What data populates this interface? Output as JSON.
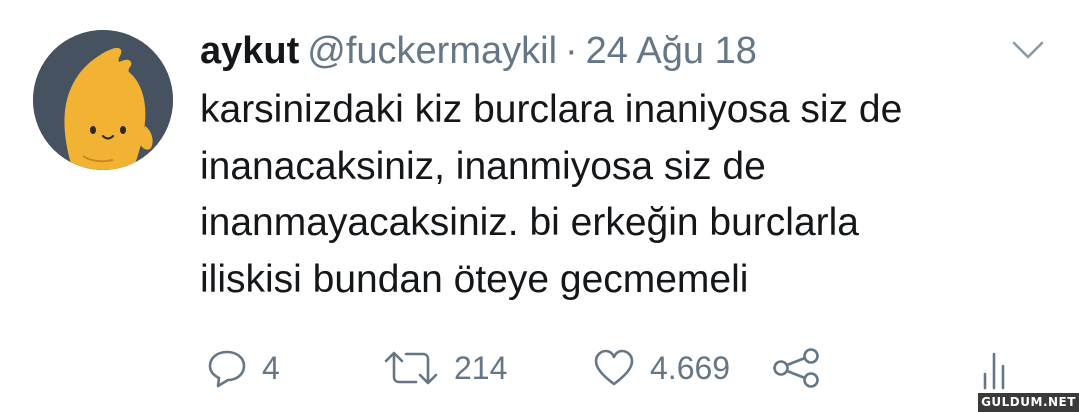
{
  "tweet": {
    "author_name": "aykut",
    "handle": "@fuckermaykil",
    "separator": "·",
    "date": "24 Ağu 18",
    "text_lines": [
      "karsinizdaki kiz burclara inaniyosa siz de",
      "inanacaksiniz, inanmiyosa siz de",
      "inanmayacaksiniz. bi erkeğin burclarla",
      "iliskisi bundan öteye gecmemeli"
    ]
  },
  "actions": {
    "replies": "4",
    "retweets": "214",
    "likes": "4.669"
  },
  "icons": {
    "reply": "reply-icon",
    "retweet": "retweet-icon",
    "like": "heart-icon",
    "share": "share-icon",
    "analytics": "analytics-icon",
    "caret": "chevron-down-icon"
  },
  "colors": {
    "text": "#14171a",
    "secondary": "#657786",
    "avatar_bg": "#475261",
    "avatar_character": "#f2b233"
  },
  "watermark": "GULDUM.NET"
}
